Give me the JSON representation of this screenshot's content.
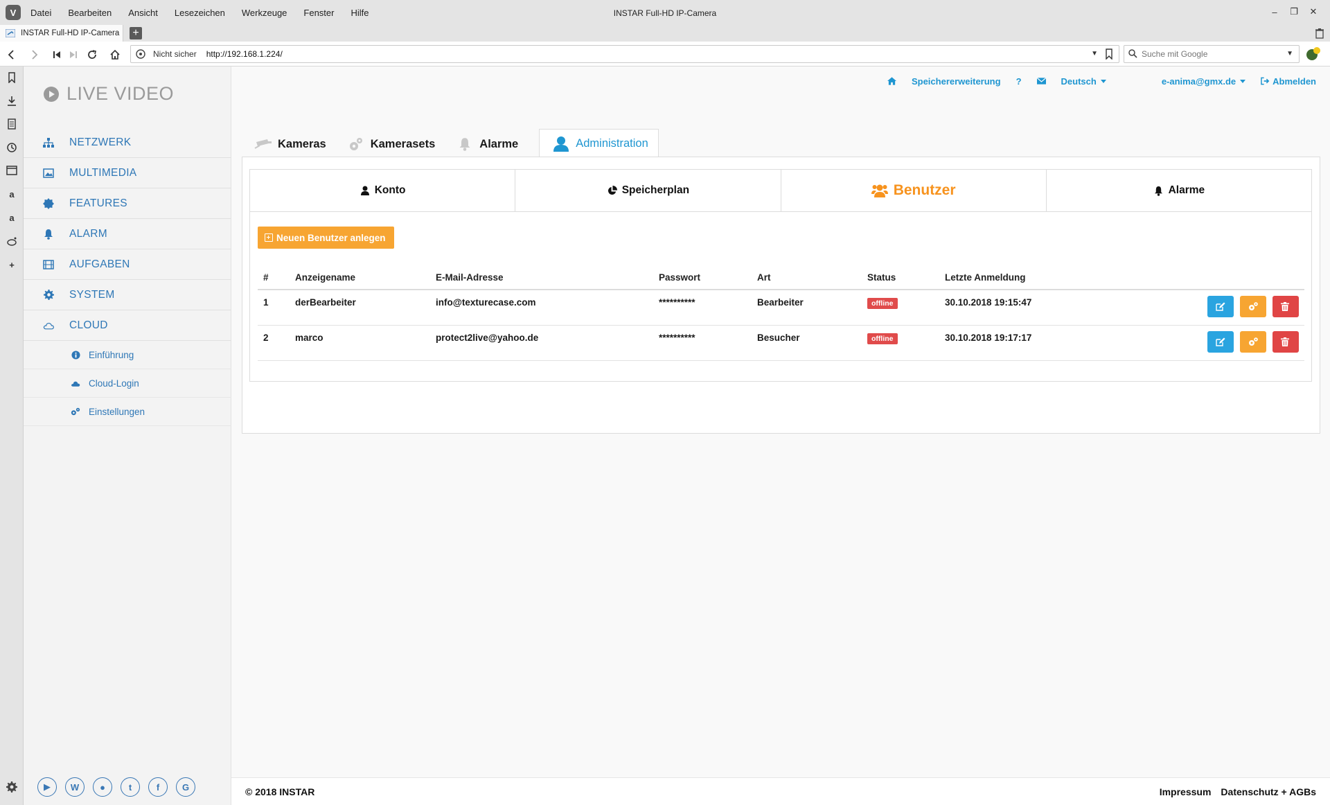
{
  "browser": {
    "menu": [
      "Datei",
      "Bearbeiten",
      "Ansicht",
      "Lesezeichen",
      "Werkzeuge",
      "Fenster",
      "Hilfe"
    ],
    "window_title": "INSTAR Full-HD IP-Camera",
    "tab_title": "INSTAR Full-HD IP-Camera",
    "security_label": "Nicht sicher",
    "url": "http://192.168.1.224/",
    "search_placeholder": "Suche mit Google"
  },
  "sidebar": {
    "brand": "LIVE VIDEO",
    "items": [
      {
        "label": "NETZWERK",
        "icon": "sitemap-icon"
      },
      {
        "label": "MULTIMEDIA",
        "icon": "image-icon"
      },
      {
        "label": "FEATURES",
        "icon": "badge-icon"
      },
      {
        "label": "ALARM",
        "icon": "bell-icon"
      },
      {
        "label": "AUFGABEN",
        "icon": "film-icon"
      },
      {
        "label": "SYSTEM",
        "icon": "gear-icon"
      },
      {
        "label": "CLOUD",
        "icon": "cloud-icon"
      }
    ],
    "subitems": [
      {
        "label": "Einführung",
        "icon": "info-icon"
      },
      {
        "label": "Cloud-Login",
        "icon": "cloud-icon"
      },
      {
        "label": "Einstellungen",
        "icon": "gears-icon"
      }
    ]
  },
  "topnav": {
    "storage": "Speichererweiterung",
    "help": "?",
    "language": "Deutsch",
    "user_email": "e-anima@gmx.de",
    "logout": "Abmelden"
  },
  "main_tabs": [
    {
      "label": "Kameras",
      "icon": "camera-icon"
    },
    {
      "label": "Kamerasets",
      "icon": "cogs-icon"
    },
    {
      "label": "Alarme",
      "icon": "bell-icon"
    },
    {
      "label": "Administration",
      "icon": "user-icon",
      "active": true
    }
  ],
  "sub_tabs": [
    {
      "label": "Konto",
      "icon": "user-icon"
    },
    {
      "label": "Speicherplan",
      "icon": "pie-chart-icon"
    },
    {
      "label": "Benutzer",
      "icon": "users-icon",
      "active": true
    },
    {
      "label": "Alarme",
      "icon": "bell-icon"
    }
  ],
  "add_user_label": "Neuen Benutzer anlegen",
  "table": {
    "headers": [
      "#",
      "Anzeigename",
      "E-Mail-Adresse",
      "Passwort",
      "Art",
      "Status",
      "Letzte Anmeldung"
    ],
    "rows": [
      {
        "num": "1",
        "name": "derBearbeiter",
        "email": "info@texturecase.com",
        "password": "**********",
        "role": "Bearbeiter",
        "status": "offline",
        "last_login": "30.10.2018 19:15:47"
      },
      {
        "num": "2",
        "name": "marco",
        "email": "protect2live@yahoo.de",
        "password": "**********",
        "role": "Besucher",
        "status": "offline",
        "last_login": "30.10.2018 19:17:17"
      }
    ]
  },
  "footer": {
    "copyright": "© 2018 INSTAR",
    "impressum": "Impressum",
    "privacy": "Datenschutz + AGBs"
  },
  "colors": {
    "accent_blue": "#1f96d1",
    "nav_blue": "#2e77b6",
    "orange": "#f7931e",
    "red": "#e04545"
  }
}
